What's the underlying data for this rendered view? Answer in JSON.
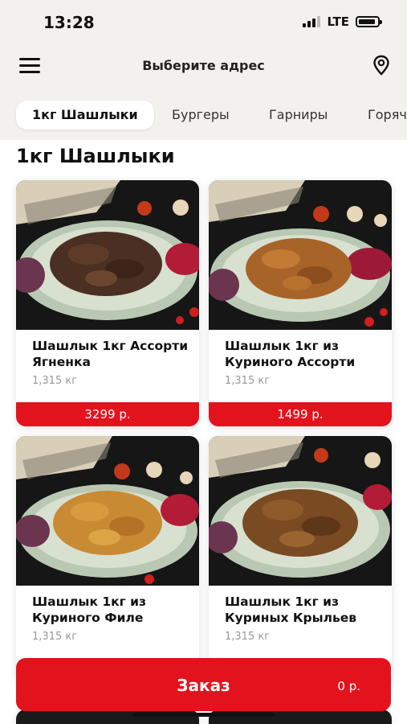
{
  "status_bar": {
    "time": "13:28",
    "network": "LTE"
  },
  "header": {
    "title": "Выберите адрес",
    "menu_icon": "hamburger-menu-icon",
    "location_icon": "map-pin-icon"
  },
  "tabs": [
    {
      "label": "1кг Шашлыки",
      "active": true
    },
    {
      "label": "Бургеры",
      "active": false
    },
    {
      "label": "Гарниры",
      "active": false
    },
    {
      "label": "Горячее",
      "active": false
    }
  ],
  "section": {
    "title": "1кг Шашлыки"
  },
  "products": [
    {
      "name": "Шашлык 1кг Ассорти Ягненка",
      "weight": "1,315 кг",
      "price": "3299 р."
    },
    {
      "name": "Шашлык 1кг из Куриного Ассорти",
      "weight": "1,315 кг",
      "price": "1499 р."
    },
    {
      "name": "Шашлык 1кг из Куриного Филе",
      "weight": "1,315 кг",
      "price": ""
    },
    {
      "name": "Шашлык 1кг из Куриных Крыльев",
      "weight": "1,315 кг",
      "price": ""
    }
  ],
  "order": {
    "label": "Заказ",
    "total": "0 р."
  },
  "colors": {
    "accent": "#e3131d",
    "background": "#f2f1ee"
  }
}
